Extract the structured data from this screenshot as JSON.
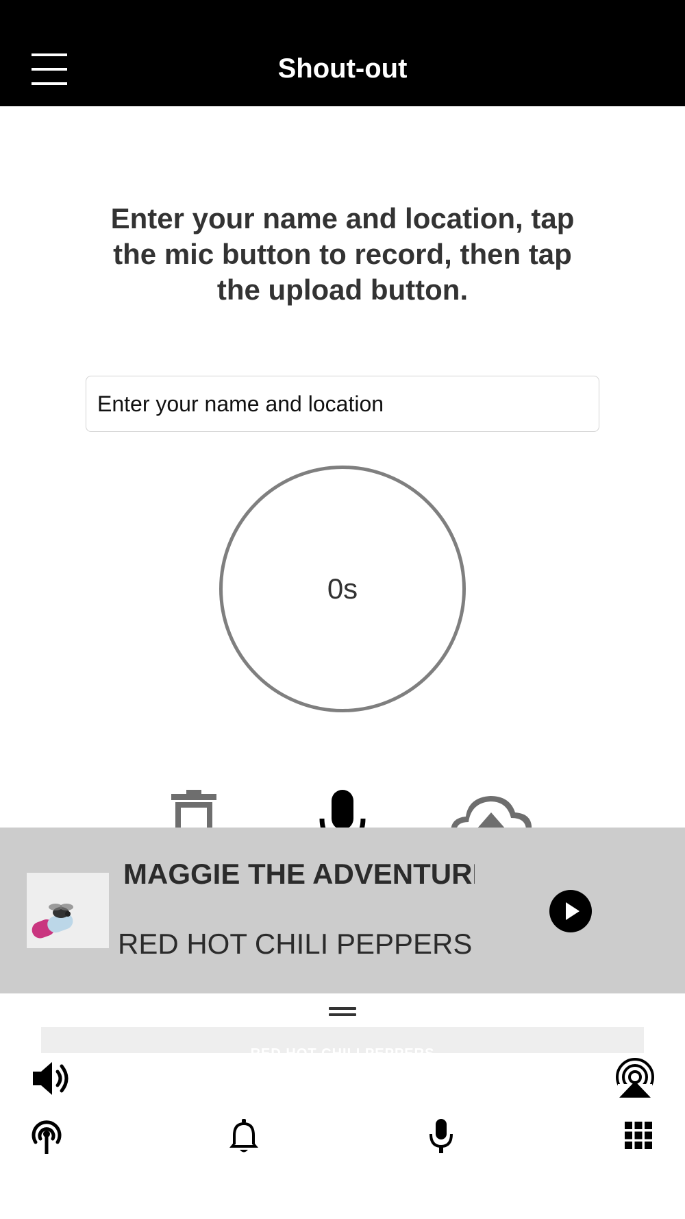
{
  "header": {
    "title": "Shout-out",
    "menu_icon": "hamburger-menu-icon"
  },
  "main": {
    "instructions": "Enter your name and location, tap the mic button to record, then tap the upload button.",
    "name_input": {
      "placeholder": "Enter your name and location",
      "value": ""
    },
    "timer": "0s",
    "actions": {
      "delete_icon": "trash-icon",
      "record_icon": "microphone-icon",
      "upload_icon": "cloud-upload-icon"
    }
  },
  "now_playing": {
    "track_title": "MAGGIE THE ADVENTURES OF RAIN DANCE MAGGIE",
    "artist": "RED HOT CHILI PEPPERS",
    "album_art_icon": "album-art-image",
    "play_icon": "play-icon"
  },
  "ticker": {
    "text": "RED HOT CHILI PEPPERS"
  },
  "controls": {
    "volume_icon": "volume-icon",
    "airplay_icon": "airplay-icon"
  },
  "bottom_nav": {
    "items": [
      {
        "icon": "broadcast-icon"
      },
      {
        "icon": "bell-icon"
      },
      {
        "icon": "microphone-icon"
      },
      {
        "icon": "grid-icon"
      }
    ]
  },
  "colors": {
    "header_bg": "#000000",
    "player_bg": "#cccccc",
    "circle_stroke": "#7f7f7f",
    "icon_gray": "#6e6e6e",
    "text_dark": "#333333"
  }
}
